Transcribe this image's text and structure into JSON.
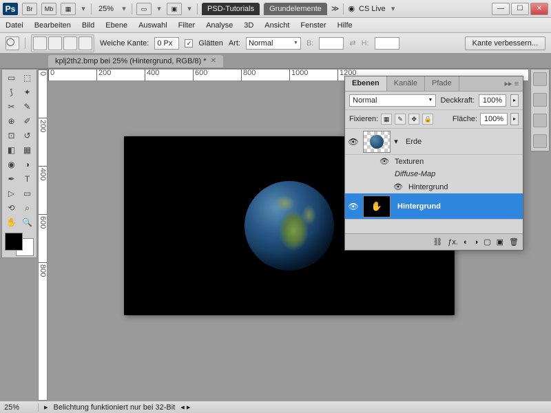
{
  "titlebar": {
    "zoom": "25%",
    "tab1": "PSD-Tutorials",
    "tab2": "Grundelemente",
    "cslive": "CS Live"
  },
  "menu": [
    "Datei",
    "Bearbeiten",
    "Bild",
    "Ebene",
    "Auswahl",
    "Filter",
    "Analyse",
    "3D",
    "Ansicht",
    "Fenster",
    "Hilfe"
  ],
  "options": {
    "weiche_kante": "Weiche Kante:",
    "weiche_val": "0 Px",
    "glatten": "Glätten",
    "art": "Art:",
    "art_val": "Normal",
    "b": "B:",
    "h": "H:",
    "refine": "Kante verbessern..."
  },
  "doc": {
    "title": "kplj2th2.bmp bei 25% (Hintergrund, RGB/8) *"
  },
  "ruler_h": [
    "0",
    "200",
    "400",
    "600",
    "800",
    "1000",
    "1200"
  ],
  "ruler_v": [
    "0",
    "200",
    "400",
    "600",
    "800"
  ],
  "layers": {
    "tabs": [
      "Ebenen",
      "Kanäle",
      "Pfade"
    ],
    "blend": "Normal",
    "opacity_lbl": "Deckkraft:",
    "opacity": "100%",
    "lock_lbl": "Fixieren:",
    "fill_lbl": "Fläche:",
    "fill": "100%",
    "layer1": "Erde",
    "sub1": "Texturen",
    "sub2": "Diffuse-Map",
    "sub3": "Hintergrund",
    "layer2": "Hintergrund"
  },
  "status": {
    "zoom": "25%",
    "msg": "Belichtung funktioniert nur bei 32-Bit"
  }
}
